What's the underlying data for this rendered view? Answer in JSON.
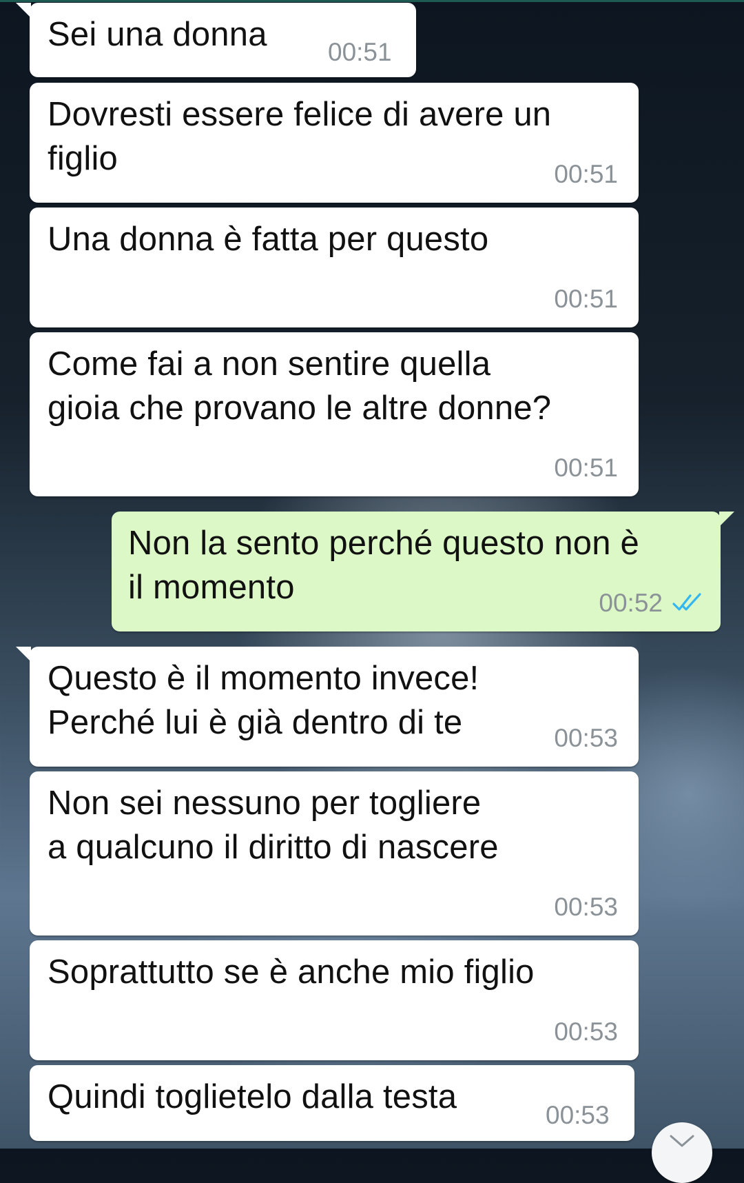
{
  "colors": {
    "incoming_bubble": "#ffffff",
    "outgoing_bubble": "#dcf8c6",
    "timestamp": "#8b9297",
    "read_ticks": "#34b7f1"
  },
  "messages": [
    {
      "direction": "incoming",
      "text": "Sei una donna",
      "time": "00:51"
    },
    {
      "direction": "incoming",
      "text": "Dovresti essere felice di avere un\nfiglio",
      "time": "00:51"
    },
    {
      "direction": "incoming",
      "text": "Una donna è fatta per questo",
      "time": "00:51"
    },
    {
      "direction": "incoming",
      "text": "Come fai a non sentire quella\ngioia che provano le altre donne?",
      "time": "00:51"
    },
    {
      "direction": "outgoing",
      "text": "Non la sento perché questo non è\nil momento",
      "time": "00:52",
      "status_icon": "double-check-read-icon"
    },
    {
      "direction": "incoming",
      "text": "Questo è il momento invece!\nPerché lui è già dentro di te",
      "time": "00:53"
    },
    {
      "direction": "incoming",
      "text": "Non sei nessuno per togliere\na qualcuno il diritto di nascere",
      "time": "00:53"
    },
    {
      "direction": "incoming",
      "text": "Soprattutto se è anche mio figlio",
      "time": "00:53"
    },
    {
      "direction": "incoming",
      "text": "Quindi toglietelo dalla testa",
      "time": "00:53"
    }
  ],
  "scroll_button": {
    "icon": "chevron-down-icon"
  }
}
